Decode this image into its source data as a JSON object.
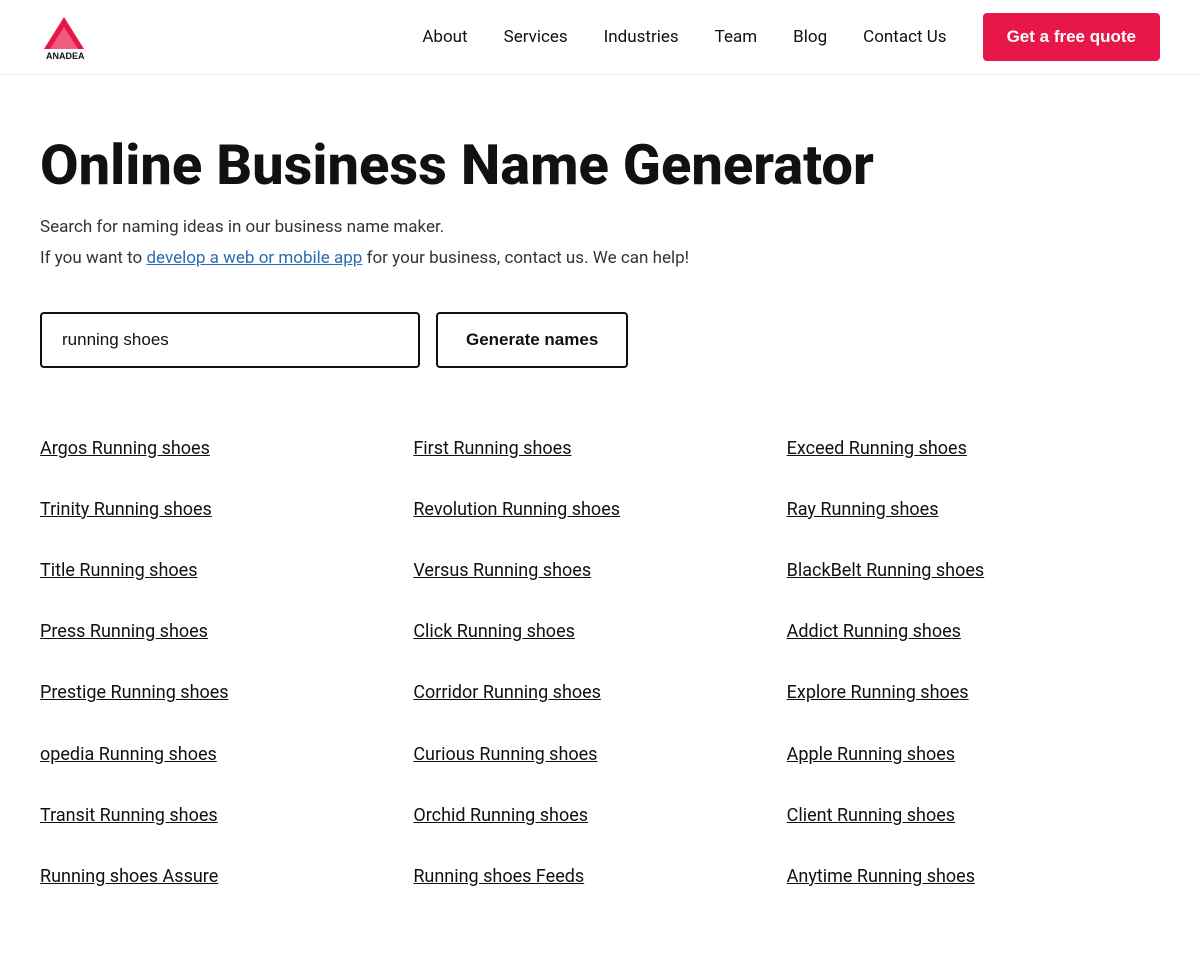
{
  "header": {
    "logo_text": "ANADEA",
    "nav": {
      "about": "About",
      "services": "Services",
      "industries": "Industries",
      "team": "Team",
      "blog": "Blog",
      "contact": "Contact Us"
    },
    "cta_label": "Get a free quote"
  },
  "main": {
    "title": "Online Business Name Generator",
    "subtitle1": "Search for naming ideas in our business name maker.",
    "subtitle2_prefix": "If you want to ",
    "subtitle2_link": "develop a web or mobile app",
    "subtitle2_suffix": " for your business, contact us. We can help!",
    "search_placeholder": "running shoes",
    "search_value": "running shoes",
    "generate_label": "Generate names"
  },
  "results": {
    "col1": [
      "Argos Running shoes",
      "Trinity Running shoes",
      "Title Running shoes",
      "Press Running shoes",
      "Prestige Running shoes",
      "opedia Running shoes",
      "Transit Running shoes",
      "Running shoes Assure"
    ],
    "col2": [
      "First Running shoes",
      "Revolution Running shoes",
      "Versus Running shoes",
      "Click Running shoes",
      "Corridor Running shoes",
      "Curious Running shoes",
      "Orchid Running shoes",
      "Running shoes Feeds"
    ],
    "col3": [
      "Exceed Running shoes",
      "Ray Running shoes",
      "BlackBelt Running shoes",
      "Addict Running shoes",
      "Explore Running shoes",
      "Apple Running shoes",
      "Client Running shoes",
      "Anytime Running shoes"
    ]
  },
  "colors": {
    "accent": "#e8174a",
    "link_color": "#2b6cb0"
  }
}
